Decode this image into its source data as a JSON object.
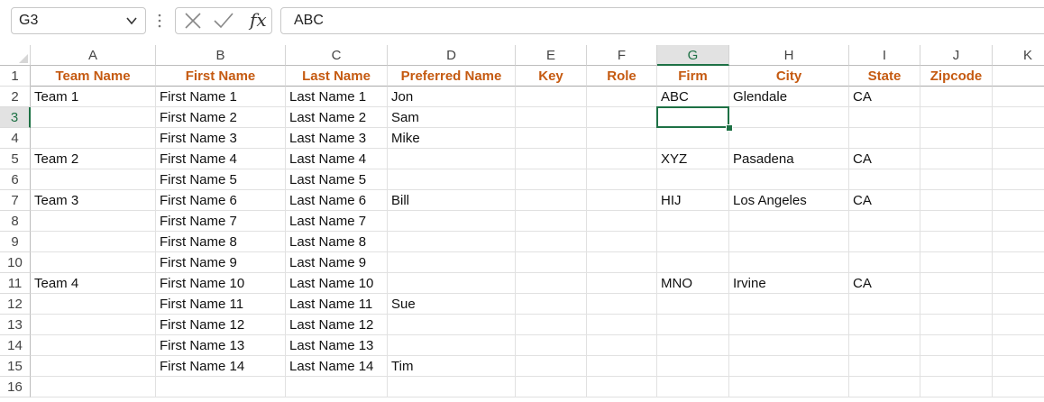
{
  "name_box": {
    "value": "G3"
  },
  "formula_bar": {
    "value": "ABC",
    "fx_label": "fx"
  },
  "icons": {
    "name_box_dropdown": "chevron-down-icon",
    "cancel": "x-icon",
    "enter": "check-icon"
  },
  "colors": {
    "header_text": "#c55a11",
    "selection": "#1e7145"
  },
  "selected_cell": {
    "col": "G",
    "row": "3"
  },
  "columns": [
    "A",
    "B",
    "C",
    "D",
    "E",
    "F",
    "G",
    "H",
    "I",
    "J",
    "K"
  ],
  "rows": [
    "1",
    "2",
    "3",
    "4",
    "5",
    "6",
    "7",
    "8",
    "9",
    "10",
    "11",
    "12",
    "13",
    "14",
    "15",
    "16"
  ],
  "header_row": [
    "Team Name",
    "First Name",
    "Last Name",
    "Preferred Name",
    "Key",
    "Role",
    "Firm",
    "City",
    "State",
    "Zipcode",
    ""
  ],
  "data_rows": [
    [
      "Team 1",
      "First Name 1",
      "Last Name 1",
      "Jon",
      "",
      "",
      "ABC",
      "Glendale",
      "CA",
      "",
      ""
    ],
    [
      "",
      "First Name 2",
      "Last Name 2",
      "Sam",
      "",
      "",
      "",
      "",
      "",
      "",
      ""
    ],
    [
      "",
      "First Name 3",
      "Last Name 3",
      "Mike",
      "",
      "",
      "",
      "",
      "",
      "",
      ""
    ],
    [
      "Team 2",
      "First Name 4",
      "Last Name 4",
      "",
      "",
      "",
      "XYZ",
      "Pasadena",
      "CA",
      "",
      ""
    ],
    [
      "",
      "First Name 5",
      "Last Name 5",
      "",
      "",
      "",
      "",
      "",
      "",
      "",
      ""
    ],
    [
      "Team 3",
      "First Name 6",
      "Last Name 6",
      "Bill",
      "",
      "",
      "HIJ",
      "Los Angeles",
      "CA",
      "",
      ""
    ],
    [
      "",
      "First Name 7",
      "Last Name 7",
      "",
      "",
      "",
      "",
      "",
      "",
      "",
      ""
    ],
    [
      "",
      "First Name 8",
      "Last Name 8",
      "",
      "",
      "",
      "",
      "",
      "",
      "",
      ""
    ],
    [
      "",
      "First Name 9",
      "Last Name 9",
      "",
      "",
      "",
      "",
      "",
      "",
      "",
      ""
    ],
    [
      "Team 4",
      "First Name 10",
      "Last Name 10",
      "",
      "",
      "",
      "MNO",
      "Irvine",
      "CA",
      "",
      ""
    ],
    [
      "",
      "First Name 11",
      "Last Name 11",
      "Sue",
      "",
      "",
      "",
      "",
      "",
      "",
      ""
    ],
    [
      "",
      "First Name 12",
      "Last Name 12",
      "",
      "",
      "",
      "",
      "",
      "",
      "",
      ""
    ],
    [
      "",
      "First Name 13",
      "Last Name 13",
      "",
      "",
      "",
      "",
      "",
      "",
      "",
      ""
    ],
    [
      "",
      "First Name 14",
      "Last Name 14",
      "Tim",
      "",
      "",
      "",
      "",
      "",
      "",
      ""
    ],
    [
      "",
      "",
      "",
      "",
      "",
      "",
      "",
      "",
      "",
      "",
      ""
    ]
  ]
}
